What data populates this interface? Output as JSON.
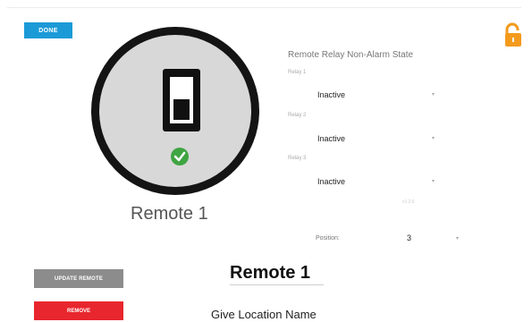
{
  "header": {
    "done_label": "DONE"
  },
  "icons": {
    "lock": "unlocked-padlock-icon",
    "device": "light-switch-icon",
    "status": "check-circle-icon"
  },
  "colors": {
    "done": "#1b9ad7",
    "lock": "#f39a1d",
    "status_ok": "#3fa442",
    "update": "#8c8c8c",
    "remove": "#e8262d"
  },
  "device": {
    "name": "Remote 1"
  },
  "relay_panel": {
    "title": "Remote Relay Non-Alarm State",
    "relays": [
      {
        "label": "Relay 1",
        "value": "Inactive"
      },
      {
        "label": "Relay 2",
        "value": "Inactive"
      },
      {
        "label": "Relay 3",
        "value": "Inactive"
      }
    ],
    "version": "v1.2.6",
    "position_label": "Position:",
    "position_value": "3"
  },
  "actions": {
    "update_label": "UPDATE REMOTE",
    "remove_label": "REMOVE"
  },
  "form": {
    "name_value": "Remote 1",
    "location_label": "Give Location Name"
  }
}
